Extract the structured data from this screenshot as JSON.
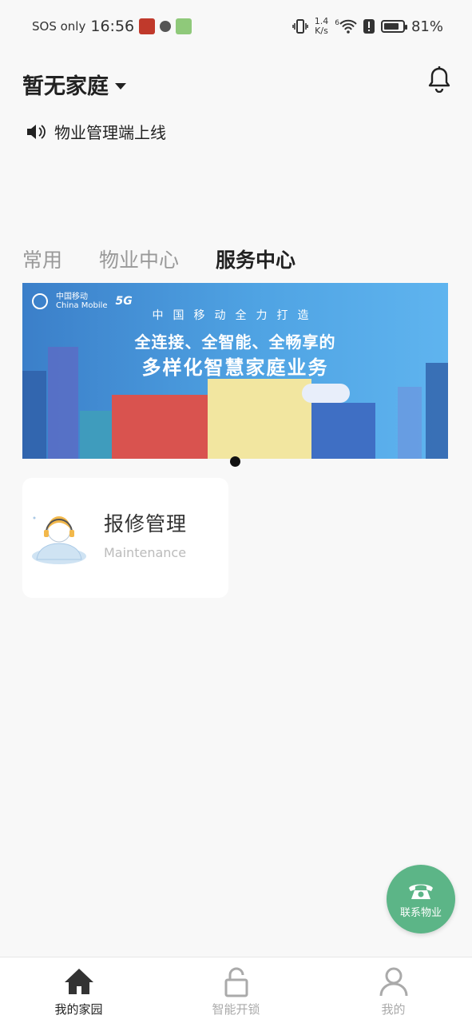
{
  "status_bar": {
    "carrier": "SOS only",
    "time": "16:56",
    "speed_value": "1.4",
    "speed_unit": "K/s",
    "signal_label": "6",
    "battery": "81%",
    "battery_level": 0.81
  },
  "header": {
    "title": "暂无家庭",
    "notice": "物业管理端上线"
  },
  "tabs": [
    {
      "label": "常用",
      "active": false
    },
    {
      "label": "物业中心",
      "active": false
    },
    {
      "label": "服务中心",
      "active": true
    }
  ],
  "banner": {
    "logo_cn": "中国移动",
    "logo_en": "China Mobile",
    "logo_5g": "5G",
    "line1": "中国移动全力打造",
    "line2": "全连接、全智能、全畅享的",
    "line3": "多样化智慧家庭业务"
  },
  "service_card": {
    "title": "报修管理",
    "subtitle": "Maintenance"
  },
  "fab": {
    "label": "联系物业"
  },
  "bottom_nav": [
    {
      "label": "我的家园",
      "icon": "home-icon",
      "active": true
    },
    {
      "label": "智能开锁",
      "icon": "lock-icon",
      "active": false
    },
    {
      "label": "我的",
      "icon": "user-icon",
      "active": false
    }
  ],
  "colors": {
    "accent_green": "#5cb587",
    "banner_blue": "#4fa3e3"
  }
}
